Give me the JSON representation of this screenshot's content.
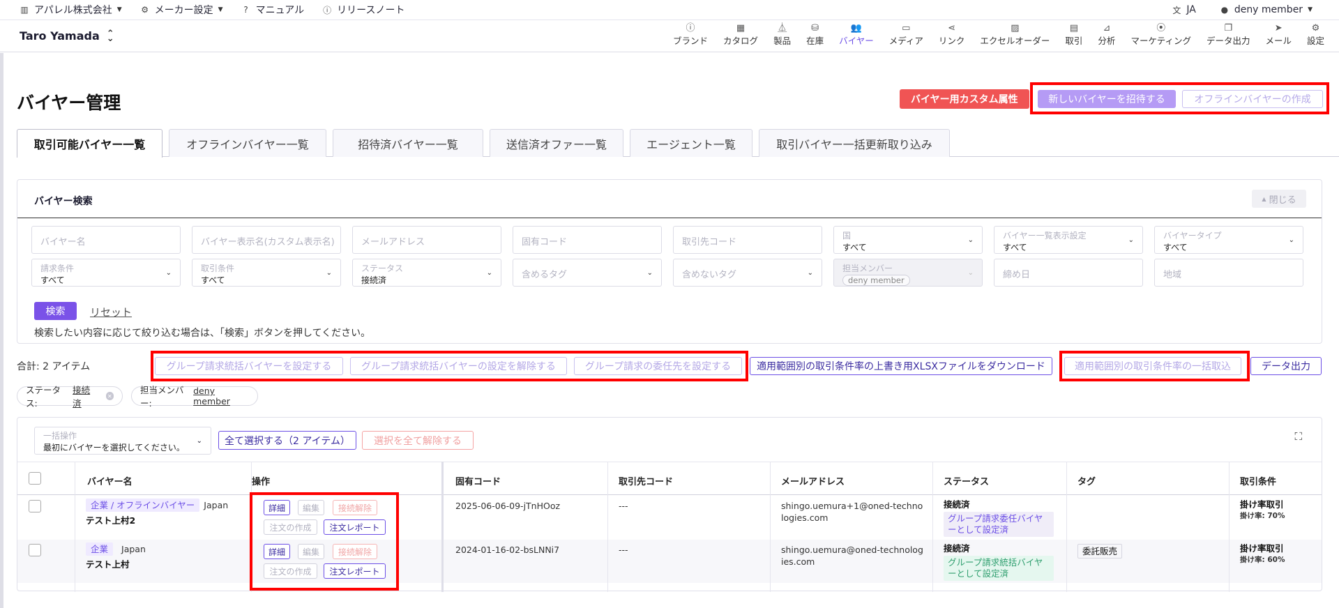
{
  "topbar": {
    "company": "アパレル株式会社",
    "maker_settings": "メーカー設定",
    "manual": "マニュアル",
    "release_notes": "リリースノート",
    "language": "JA",
    "user": "deny member"
  },
  "store": {
    "name": "Taro Yamada"
  },
  "nav": [
    {
      "label": "ブランド",
      "icon": "info-icon",
      "glyph": "ⓘ"
    },
    {
      "label": "カタログ",
      "icon": "catalog-icon",
      "glyph": "▦"
    },
    {
      "label": "製品",
      "icon": "hanger-icon",
      "glyph": "⏅"
    },
    {
      "label": "在庫",
      "icon": "boxes-icon",
      "glyph": "⛁"
    },
    {
      "label": "バイヤー",
      "icon": "users-icon",
      "glyph": "👥",
      "active": true
    },
    {
      "label": "メディア",
      "icon": "cast-icon",
      "glyph": "▭"
    },
    {
      "label": "リンク",
      "icon": "share-icon",
      "glyph": "⋖"
    },
    {
      "label": "エクセルオーダー",
      "icon": "excel-icon",
      "glyph": "▨"
    },
    {
      "label": "取引",
      "icon": "message-icon",
      "glyph": "▤"
    },
    {
      "label": "分析",
      "icon": "chart-icon",
      "glyph": "⊿"
    },
    {
      "label": "マーケティング",
      "icon": "broadcast-icon",
      "glyph": "⦿"
    },
    {
      "label": "データ出力",
      "icon": "copy-icon",
      "glyph": "❐"
    },
    {
      "label": "メール",
      "icon": "send-icon",
      "glyph": "➤"
    },
    {
      "label": "設定",
      "icon": "gear-icon",
      "glyph": "⚙"
    }
  ],
  "header": {
    "title": "バイヤー管理",
    "custom_attr_btn": "バイヤー用カスタム属性",
    "invite_btn": "新しいバイヤーを招待する",
    "offline_btn": "オフラインバイヤーの作成"
  },
  "tabs": [
    "取引可能バイヤー一覧",
    "オフラインバイヤー一覧",
    "招待済バイヤー一覧",
    "送信済オファー一覧",
    "エージェント一覧",
    "取引バイヤー一括更新取り込み"
  ],
  "search": {
    "title": "バイヤー検索",
    "close": "閉じる",
    "fields_row1": [
      {
        "label": "バイヤー名"
      },
      {
        "label": "バイヤー表示名(カスタム表示名)"
      },
      {
        "label": "メールアドレス"
      },
      {
        "label": "固有コード"
      },
      {
        "label": "取引先コード"
      },
      {
        "label": "国",
        "value": "すべて"
      },
      {
        "label": "バイヤー一覧表示設定",
        "value": "すべて"
      },
      {
        "label": "バイヤータイプ",
        "value": "すべて"
      }
    ],
    "fields_row2": [
      {
        "label": "請求条件",
        "value": "すべて"
      },
      {
        "label": "取引条件",
        "value": "すべて"
      },
      {
        "label": "ステータス",
        "value": "接続済"
      },
      {
        "label": "含めるタグ"
      },
      {
        "label": "含めないタグ"
      },
      {
        "label": "担当メンバー",
        "value": "deny member"
      },
      {
        "label": "締め日"
      },
      {
        "label": "地域"
      }
    ],
    "search_btn": "検索",
    "reset_link": "リセット",
    "hint": "検索したい内容に応じて絞り込む場合は、「検索」ボタンを押してください。"
  },
  "actions": {
    "total": "合計: 2 アイテム",
    "set_group": "グループ請求統括バイヤーを設定する",
    "unset_group": "グループ請求統括バイヤーの設定を解除する",
    "set_delegate": "グループ請求の委任先を設定する",
    "download_xlsx": "適用範囲別の取引条件率の上書き用XLSXファイルをダウンロード",
    "bulk_import": "適用範囲別の取引条件率の一括取込",
    "export": "データ出力"
  },
  "filters": {
    "status_label": "ステータス:",
    "status_value": "接続済",
    "member_label": "担当メンバー:",
    "member_value": "deny member"
  },
  "table": {
    "bulk_label": "一括操作",
    "bulk_value": "最初にバイヤーを選択してください。",
    "select_all": "全て選択する（2 アイテム）",
    "deselect_all": "選択を全て解除する",
    "columns": [
      "バイヤー名",
      "操作",
      "固有コード",
      "取引先コード",
      "メールアドレス",
      "ステータス",
      "タグ",
      "取引条件"
    ],
    "op_labels": {
      "detail": "詳細",
      "edit": "編集",
      "disconnect": "接続解除",
      "create_order": "注文の作成",
      "order_report": "注文レポート"
    },
    "rows": [
      {
        "type": "企業 / オフラインバイヤー",
        "country": "Japan",
        "name": "テスト上村2",
        "code": "2025-06-06-09-jTnHOoz",
        "partner_code": "---",
        "email": "shingo.uemura+1@oned-technologies.com",
        "status": "接続済",
        "status_badge": "グループ請求委任バイヤーとして設定済",
        "badge_color": "purple",
        "tag": "",
        "condition": "掛け率取引",
        "rate": "掛け率: 70%"
      },
      {
        "type": "企業",
        "country": "Japan",
        "name": "テスト上村",
        "code": "2024-01-16-02-bsLNNi7",
        "partner_code": "---",
        "email": "shingo.uemura@oned-technologies.com",
        "status": "接続済",
        "status_badge": "グループ請求統括バイヤーとして設定済",
        "badge_color": "green",
        "tag": "委託販売",
        "condition": "掛け率取引",
        "rate": "掛け率: 60%"
      }
    ]
  }
}
